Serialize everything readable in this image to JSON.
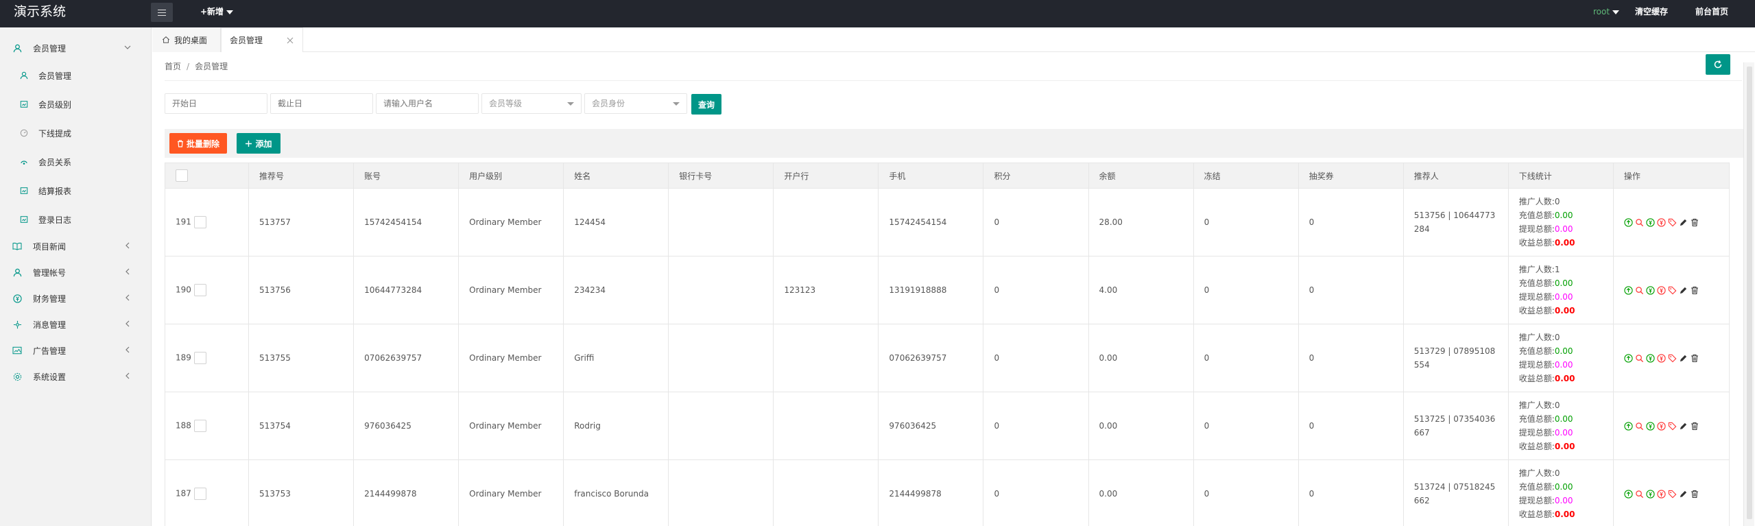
{
  "header": {
    "logo": "演示系统",
    "new_label": "+新增",
    "user": "root",
    "clear_cache": "清空缓存",
    "front_home": "前台首页"
  },
  "sidebar": {
    "groups": [
      {
        "label": "会员管理",
        "icon": "user-icon",
        "expanded": true
      },
      {
        "label": "项目新闻",
        "icon": "book-icon"
      },
      {
        "label": "管理帐号",
        "icon": "admin-user-icon"
      },
      {
        "label": "财务管理",
        "icon": "finance-icon"
      },
      {
        "label": "消息管理",
        "icon": "message-icon"
      },
      {
        "label": "广告管理",
        "icon": "image-icon"
      },
      {
        "label": "系统设置",
        "icon": "gear-icon"
      }
    ],
    "subitems": [
      {
        "label": "会员管理",
        "icon": "user-icon"
      },
      {
        "label": "会员级别",
        "icon": "level-icon"
      },
      {
        "label": "下线提成",
        "icon": "gauge-icon"
      },
      {
        "label": "会员关系",
        "icon": "relation-icon"
      },
      {
        "label": "结算报表",
        "icon": "report-icon"
      },
      {
        "label": "登录日志",
        "icon": "log-icon"
      }
    ]
  },
  "tabs": {
    "home": "我的桌面",
    "active": "会员管理"
  },
  "breadcrumb": {
    "home": "首页",
    "sep": "/",
    "current": "会员管理"
  },
  "filters": {
    "start_date": "开始日",
    "end_date": "截止日",
    "username": "请输入用户名",
    "level": "会员等级",
    "identity": "会员身份",
    "query": "查询"
  },
  "toolbar": {
    "batch_delete": "批量删除",
    "add": "添加"
  },
  "table": {
    "columns": [
      "推荐号",
      "账号",
      "用户级别",
      "姓名",
      "银行卡号",
      "开户行",
      "手机",
      "积分",
      "余额",
      "冻结",
      "抽奖券",
      "推荐人",
      "下线统计",
      "操作"
    ],
    "stat_labels": {
      "promoters": "推广人数:",
      "recharge": "充值总额:",
      "withdraw": "提现总额:",
      "income": "收益总额:"
    },
    "rows": [
      {
        "id": "191",
        "ref_no": "513757",
        "account": "15742454154",
        "level": "Ordinary Member",
        "name": "124454",
        "bank_card": "",
        "bank": "",
        "phone": "15742454154",
        "points": "0",
        "balance": "28.00",
        "frozen": "0",
        "tickets": "0",
        "referrer": "513756 | 10644773284",
        "promoters": "0",
        "recharge": "0.00",
        "withdraw": "0.00",
        "income": "0.00"
      },
      {
        "id": "190",
        "ref_no": "513756",
        "account": "10644773284",
        "level": "Ordinary Member",
        "name": "234234",
        "bank_card": "",
        "bank": "123123",
        "phone": "13191918888",
        "points": "0",
        "balance": "4.00",
        "frozen": "0",
        "tickets": "0",
        "referrer": "",
        "promoters": "1",
        "recharge": "0.00",
        "withdraw": "0.00",
        "income": "0.00"
      },
      {
        "id": "189",
        "ref_no": "513755",
        "account": "07062639757",
        "level": "Ordinary Member",
        "name": "Griffi",
        "bank_card": "",
        "bank": "",
        "phone": "07062639757",
        "points": "0",
        "balance": "0.00",
        "frozen": "0",
        "tickets": "0",
        "referrer": "513729 | 07895108554",
        "promoters": "0",
        "recharge": "0.00",
        "withdraw": "0.00",
        "income": "0.00"
      },
      {
        "id": "188",
        "ref_no": "513754",
        "account": "976036425",
        "level": "Ordinary Member",
        "name": "Rodrig",
        "bank_card": "",
        "bank": "",
        "phone": "976036425",
        "points": "0",
        "balance": "0.00",
        "frozen": "0",
        "tickets": "0",
        "referrer": "513725 | 07354036667",
        "promoters": "0",
        "recharge": "0.00",
        "withdraw": "0.00",
        "income": "0.00"
      },
      {
        "id": "187",
        "ref_no": "513753",
        "account": "2144499878",
        "level": "Ordinary Member",
        "name": "francisco Borunda",
        "bank_card": "",
        "bank": "",
        "phone": "2144499878",
        "points": "0",
        "balance": "0.00",
        "frozen": "0",
        "tickets": "0",
        "referrer": "513724 | 07518245662",
        "promoters": "0",
        "recharge": "0.00",
        "withdraw": "0.00",
        "income": "0.00"
      }
    ]
  },
  "colors": {
    "header_bg": "#23262e",
    "primary": "#009688",
    "danger": "#ff5722",
    "green": "#009f00",
    "pink": "#ff00ff",
    "red": "#ff0000"
  }
}
